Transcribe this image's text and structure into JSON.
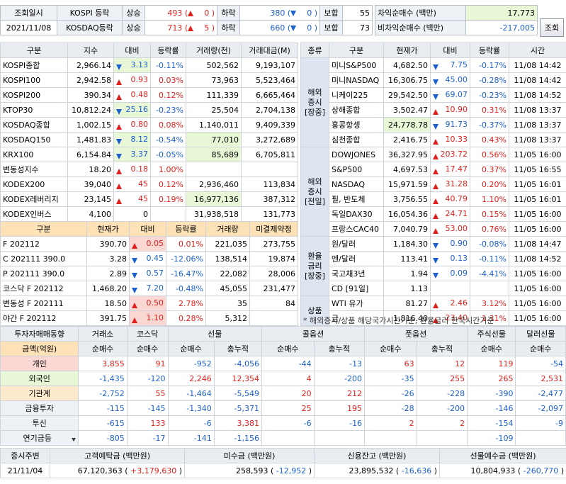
{
  "top": {
    "date_label": "조회일시",
    "date_value": "2021/11/08",
    "rows": [
      {
        "name": "KOSPI 등락",
        "up_label": "상승",
        "up": "493",
        "up_chg": "0",
        "down_label": "하락",
        "down": "380",
        "down_chg": "0",
        "flat_label": "보합",
        "flat": "55"
      },
      {
        "name": "KOSDAQ등락",
        "up_label": "상승",
        "up": "713",
        "up_chg": "5",
        "down_label": "하락",
        "down": "660",
        "down_chg": "0",
        "flat_label": "보합",
        "flat": "73"
      }
    ],
    "arb": [
      {
        "label": "차익순매수",
        "unit": "(백만)",
        "value": "17,773"
      },
      {
        "label": "비차익순매수",
        "unit": "(백만)",
        "value": "-217,005"
      }
    ],
    "search_button": "조회"
  },
  "index": {
    "headers": [
      "구분",
      "지수",
      "대비",
      "등락률",
      "거래량(천)",
      "거래대금(M)"
    ],
    "rows": [
      {
        "name": "KOSPI종합",
        "v": "2,966.14",
        "dir": "down",
        "chg": "3.13",
        "rate": "-0.11%",
        "vol": "502,562",
        "amt": "9,193,107"
      },
      {
        "name": "KOSPI100",
        "v": "2,942.58",
        "dir": "up",
        "chg": "0.93",
        "rate": "0.03%",
        "vol": "73,963",
        "amt": "5,523,464"
      },
      {
        "name": "KOSPI200",
        "v": "390.34",
        "dir": "up",
        "chg": "0.48",
        "rate": "0.12%",
        "vol": "111,339",
        "amt": "6,665,464"
      },
      {
        "name": "KTOP30",
        "v": "10,812.24",
        "dir": "down",
        "chg": "25.16",
        "rate": "-0.23%",
        "vol": "25,504",
        "amt": "2,704,138"
      },
      {
        "name": "KOSDAQ종합",
        "v": "1,002.15",
        "dir": "up",
        "chg": "0.80",
        "rate": "0.08%",
        "vol": "1,140,011",
        "amt": "9,409,339"
      },
      {
        "name": "KOSDAQ150",
        "v": "1,481.83",
        "dir": "down",
        "chg": "8.12",
        "rate": "-0.54%",
        "vol": "77,010",
        "amt": "3,272,689"
      },
      {
        "name": "KRX100",
        "v": "6,154.84",
        "dir": "down",
        "chg": "3.37",
        "rate": "-0.05%",
        "vol": "85,689",
        "amt": "6,705,811"
      },
      {
        "name": "변동성지수",
        "v": "18.20",
        "dir": "up",
        "chg": "0.18",
        "rate": "1.00%",
        "vol": "",
        "amt": ""
      },
      {
        "name": "KODEX200",
        "v": "39,040",
        "dir": "up",
        "chg": "45",
        "rate": "0.12%",
        "vol": "2,936,460",
        "amt": "113,834"
      },
      {
        "name": "KODEX레버리지",
        "v": "23,145",
        "dir": "up",
        "chg": "45",
        "rate": "0.19%",
        "vol": "16,977,136",
        "amt": "387,312"
      },
      {
        "name": "KODEX인버스",
        "v": "4,100",
        "dir": "none",
        "chg": "0",
        "rate": "",
        "vol": "31,938,518",
        "amt": "131,773"
      }
    ]
  },
  "futures": {
    "headers": [
      "구분",
      "현재가",
      "대비",
      "등락률",
      "거래량",
      "미결제약정"
    ],
    "rows": [
      {
        "name": "F 202112",
        "v": "390.70",
        "dir": "up",
        "chg": "0.05",
        "rate": "0.01%",
        "vol": "221,035",
        "oi": "273,755"
      },
      {
        "name": "C 202111 390.0",
        "v": "3.28",
        "dir": "down",
        "chg": "0.45",
        "rate": "-12.06%",
        "vol": "138,514",
        "oi": "19,874"
      },
      {
        "name": "P 202111 390.0",
        "v": "2.89",
        "dir": "down",
        "chg": "0.57",
        "rate": "-16.47%",
        "vol": "22,082",
        "oi": "28,006"
      },
      {
        "name": "코스닥 F 202112",
        "v": "1,468.20",
        "dir": "down",
        "chg": "7.20",
        "rate": "-0.48%",
        "vol": "45,055",
        "oi": "231,477"
      },
      {
        "name": "변동성 F 202111",
        "v": "18.50",
        "dir": "up",
        "chg": "0.50",
        "rate": "2.78%",
        "vol": "35",
        "oi": "84"
      },
      {
        "name": "야간 F 202112",
        "v": "391.75",
        "dir": "up",
        "chg": "1.10",
        "rate": "0.28%",
        "vol": "5,312",
        "oi": ""
      }
    ]
  },
  "world": {
    "headers": [
      "종류",
      "구분",
      "현재가",
      "대비",
      "등락률",
      "시간"
    ],
    "groups": [
      {
        "label": "해외\n증시\n[장중]",
        "rows": [
          {
            "name": "미니S&P500",
            "v": "4,682.50",
            "dir": "down",
            "chg": "7.75",
            "rate": "-0.17%",
            "time": "11/08 14:42"
          },
          {
            "name": "미니NASDAQ",
            "v": "16,306.75",
            "dir": "down",
            "chg": "45.00",
            "rate": "-0.28%",
            "time": "11/08 14:42"
          },
          {
            "name": "니케이225",
            "v": "29,542.50",
            "dir": "down",
            "chg": "69.07",
            "rate": "-0.23%",
            "time": "11/08 14:52"
          },
          {
            "name": "상해종합",
            "v": "3,502.47",
            "dir": "up",
            "chg": "10.90",
            "rate": "0.31%",
            "time": "11/08 13:37"
          },
          {
            "name": "홍콩항셍",
            "v": "24,778.78",
            "dir": "down",
            "chg": "91.73",
            "rate": "-0.37%",
            "time": "11/08 13:37"
          },
          {
            "name": "심천종합",
            "v": "2,416.75",
            "dir": "up",
            "chg": "10.33",
            "rate": "0.43%",
            "time": "11/08 13:37"
          }
        ]
      },
      {
        "label": "해외\n증시\n[전일]",
        "rows": [
          {
            "name": "DOWJONES",
            "v": "36,327.95",
            "dir": "up",
            "chg": "203.72",
            "rate": "0.56%",
            "time": "11/05 16:00"
          },
          {
            "name": "S&P500",
            "v": "4,697.53",
            "dir": "up",
            "chg": "17.47",
            "rate": "0.37%",
            "time": "11/05 16:55"
          },
          {
            "name": "NASDAQ",
            "v": "15,971.59",
            "dir": "up",
            "chg": "31.28",
            "rate": "0.20%",
            "time": "11/05 16:01"
          },
          {
            "name": "필, 반도체",
            "v": "3,756.55",
            "dir": "up",
            "chg": "40.79",
            "rate": "1.10%",
            "time": "11/05 16:01"
          },
          {
            "name": "독일DAX30",
            "v": "16,054.36",
            "dir": "up",
            "chg": "24.71",
            "rate": "0.15%",
            "time": "11/05 16:00"
          },
          {
            "name": "프랑스CAC40",
            "v": "7,040.79",
            "dir": "up",
            "chg": "53.00",
            "rate": "0.76%",
            "time": "11/05 16:00"
          }
        ]
      },
      {
        "label": "환율\n금리\n[장중]",
        "rows": [
          {
            "name": "원/달러",
            "v": "1,184.30",
            "dir": "down",
            "chg": "0.90",
            "rate": "-0.08%",
            "time": "11/08 14:47"
          },
          {
            "name": "엔/달러",
            "v": "113.41",
            "dir": "down",
            "chg": "0.13",
            "rate": "-0.11%",
            "time": "11/08 14:52"
          },
          {
            "name": "국고채3년",
            "v": "1.94",
            "dir": "down",
            "chg": "0.09",
            "rate": "-4.41%",
            "time": "11/05 16:00"
          },
          {
            "name": "CD [91일]",
            "v": "1.13",
            "dir": "none",
            "chg": "",
            "rate": "",
            "time": "11/05 16:00"
          }
        ]
      },
      {
        "label": "상품",
        "rows": [
          {
            "name": "WTI 유가",
            "v": "81.27",
            "dir": "up",
            "chg": "2.46",
            "rate": "3.12%",
            "time": "11/05 16:00"
          },
          {
            "name": "금",
            "v": "1,816.40",
            "dir": "up",
            "chg": "23.40",
            "rate": "1.31%",
            "time": "11/05 16:00"
          }
        ]
      }
    ],
    "note": "* 해외증시/상품 해당국가시간기준, 환율금리 한국시간기준"
  },
  "investor": {
    "title": "투자자매매동향",
    "groups": [
      "거래소",
      "코스닥",
      "선물",
      "콜옵션",
      "풋옵션",
      "주식선물",
      "달러선물"
    ],
    "unit_label": "금액(억원)",
    "subheaders": [
      "순매수",
      "순매수",
      "순매수",
      "총누적",
      "순매수",
      "총누적",
      "순매수",
      "총누적",
      "순매수",
      "순매수"
    ],
    "rows": [
      {
        "name": "개인",
        "vals": [
          "3,855",
          "91",
          "-952",
          "-4,056",
          "-44",
          "-13",
          "63",
          "12",
          "119",
          "-54"
        ]
      },
      {
        "name": "외국인",
        "vals": [
          "-1,435",
          "-120",
          "2,246",
          "12,354",
          "4",
          "-200",
          "-35",
          "255",
          "265",
          "2,531"
        ]
      },
      {
        "name": "기관계",
        "vals": [
          "-2,752",
          "55",
          "-1,464",
          "-5,549",
          "20",
          "212",
          "-26",
          "-228",
          "-390",
          "-2,477"
        ]
      },
      {
        "name": "금융투자",
        "vals": [
          "-115",
          "-145",
          "-1,340",
          "-5,371",
          "25",
          "195",
          "-28",
          "-200",
          "-146",
          "-2,097"
        ]
      },
      {
        "name": "투신",
        "vals": [
          "-615",
          "133",
          "-6",
          "3,381",
          "-6",
          "-16",
          "2",
          "2",
          "-154",
          "-9"
        ]
      },
      {
        "name": "연기금등",
        "vals": [
          "-805",
          "-17",
          "-141",
          "-1,156",
          "",
          "",
          "",
          "",
          "-109",
          ""
        ]
      }
    ]
  },
  "bottom": {
    "headers": [
      "증시주변",
      "고객예탁금 (백만원)",
      "미수금 (백만원)",
      "신용잔고 (백만원)",
      "선물예수금 (백만원)"
    ],
    "date": "21/11/04",
    "items": [
      {
        "v": "67,120,363",
        "c": "+3,179,630"
      },
      {
        "v": "258,593",
        "c": "-12,952"
      },
      {
        "v": "23,895,532",
        "c": "-16,636"
      },
      {
        "v": "10,804,933",
        "c": "-260,770"
      }
    ]
  },
  "colors": {
    "up": "#e0201c",
    "down": "#1c5fd0",
    "header_bg": "#e9edf2",
    "highlight": "#e8f7d6",
    "orange": "#fde2b8"
  }
}
